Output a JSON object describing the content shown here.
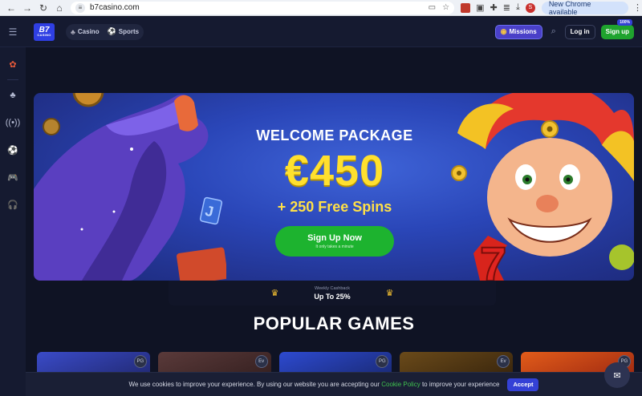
{
  "browser": {
    "url": "b7casino.com",
    "update_label": "New Chrome available",
    "profile_initial": "S"
  },
  "header": {
    "logo_text": "B7",
    "logo_sub": "CASINO",
    "categories": [
      {
        "label": "Casino",
        "icon": "cherries-icon"
      },
      {
        "label": "Sports",
        "icon": "soccer-ball-icon"
      }
    ],
    "missions_label": "Missions",
    "login_label": "Log in",
    "signup_label": "Sign up",
    "signup_badge": "100%"
  },
  "sidebar": {
    "items": [
      {
        "name": "promo-icon"
      },
      {
        "name": "casino-icon"
      },
      {
        "name": "live-icon"
      },
      {
        "name": "sports-icon"
      },
      {
        "name": "esports-icon"
      },
      {
        "name": "support-icon"
      }
    ]
  },
  "hero": {
    "title": "WELCOME PACKAGE",
    "amount": "€450",
    "spins": "+ 250 Free Spins",
    "cta_label": "Sign Up Now",
    "cta_sub": "It only takes a minute"
  },
  "cashback": {
    "label": "Weekly Cashback",
    "value": "Up To 25%"
  },
  "popular": {
    "title": "POPULAR GAMES",
    "games": [
      {
        "tag": "PG",
        "color": "#2a2f7a"
      },
      {
        "tag": "Ev",
        "color": "#3a2a2a"
      },
      {
        "tag": "PG",
        "color": "#1a2a6a"
      },
      {
        "tag": "Ev",
        "color": "#3a2a12"
      },
      {
        "tag": "PG",
        "color": "#7a1e10"
      }
    ]
  },
  "cookie": {
    "message": "We use cookies to improve your experience. By using our website you are accepting our",
    "policy_link": "Cookie Policy",
    "message_end": "to improve your experience",
    "accept_label": "Accept"
  },
  "colors": {
    "accent_green": "#1db32f",
    "accent_blue": "#3441d6",
    "gold": "#ffe02e"
  }
}
